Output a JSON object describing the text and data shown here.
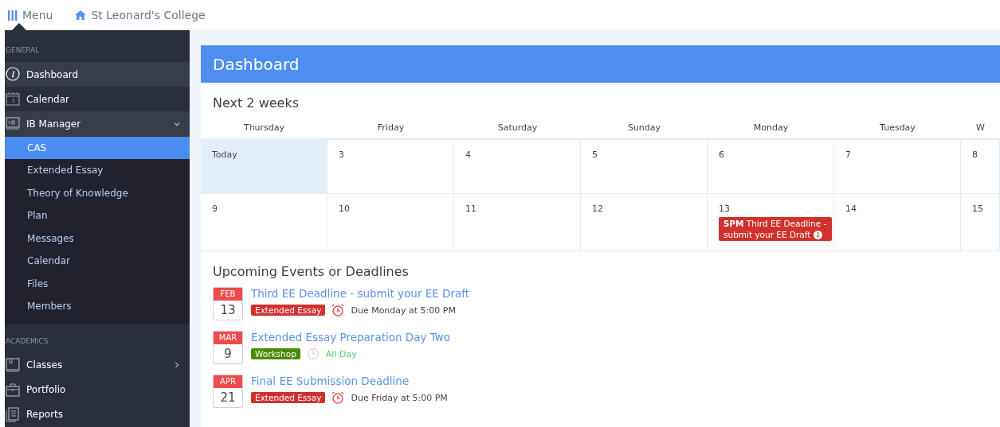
{
  "topbar": {
    "menu_label": "Menu",
    "school": "St Leonard's College"
  },
  "sidebar": {
    "sections": [
      {
        "heading": "GENERAL",
        "items": [
          {
            "label": "Dashboard",
            "selected": true
          },
          {
            "label": "Calendar",
            "selected": false
          },
          {
            "label": "IB Manager",
            "selected": true,
            "expanded": true,
            "children": [
              {
                "label": "CAS",
                "selected": true
              },
              {
                "label": "Extended Essay",
                "selected": false
              },
              {
                "label": "Theory of Knowledge",
                "selected": false
              },
              {
                "label": "Plan",
                "selected": false
              },
              {
                "label": "Messages",
                "selected": false
              },
              {
                "label": "Calendar",
                "selected": false
              },
              {
                "label": "Files",
                "selected": false
              },
              {
                "label": "Members",
                "selected": false
              }
            ]
          }
        ]
      },
      {
        "heading": "ACADEMICS",
        "items": [
          {
            "label": "Classes",
            "selected": false,
            "expanded": false
          },
          {
            "label": "Portfolio",
            "selected": false
          },
          {
            "label": "Reports",
            "selected": false
          }
        ]
      }
    ]
  },
  "dashboard": {
    "title": "Dashboard",
    "calendar": {
      "title": "Next 2 weeks",
      "days": [
        "Thursday",
        "Friday",
        "Saturday",
        "Sunday",
        "Monday",
        "Tuesday",
        "W"
      ],
      "weeks": [
        {
          "cells": [
            {
              "label": "Today",
              "today": true
            },
            {
              "label": "3",
              "today": false
            },
            {
              "label": "4",
              "today": false
            },
            {
              "label": "5",
              "today": false
            },
            {
              "label": "6",
              "today": false
            },
            {
              "label": "7",
              "today": false
            },
            {
              "label": "8",
              "today": false
            }
          ]
        },
        {
          "cells": [
            {
              "label": "9",
              "today": false
            },
            {
              "label": "10",
              "today": false
            },
            {
              "label": "11",
              "today": false
            },
            {
              "label": "12",
              "today": false
            },
            {
              "label": "13",
              "today": false,
              "events": [
                {
                  "time": "5PM",
                  "title": "Third EE Deadline - submit your EE Draft"
                }
              ]
            },
            {
              "label": "14",
              "today": false
            },
            {
              "label": "15",
              "today": false
            }
          ]
        }
      ]
    },
    "upcoming": {
      "title": "Upcoming Events or Deadlines",
      "items": [
        {
          "month": "FEB",
          "day": "13",
          "title": "Third EE Deadline - submit your EE Draft",
          "tag": {
            "label": "Extended Essay",
            "color": "#d0312d"
          },
          "kind": "deadline",
          "when": "Due Monday at 5:00 PM"
        },
        {
          "month": "MAR",
          "day": "9",
          "title": "Extended Essay Preparation Day Two",
          "tag": {
            "label": "Workshop",
            "color": "#4a8a0c"
          },
          "kind": "all_day",
          "when": "All Day"
        },
        {
          "month": "APR",
          "day": "21",
          "title": "Final EE Submission Deadline",
          "tag": {
            "label": "Extended Essay",
            "color": "#d0312d"
          },
          "kind": "deadline",
          "when": "Due Friday at 5:00 PM"
        }
      ]
    }
  }
}
